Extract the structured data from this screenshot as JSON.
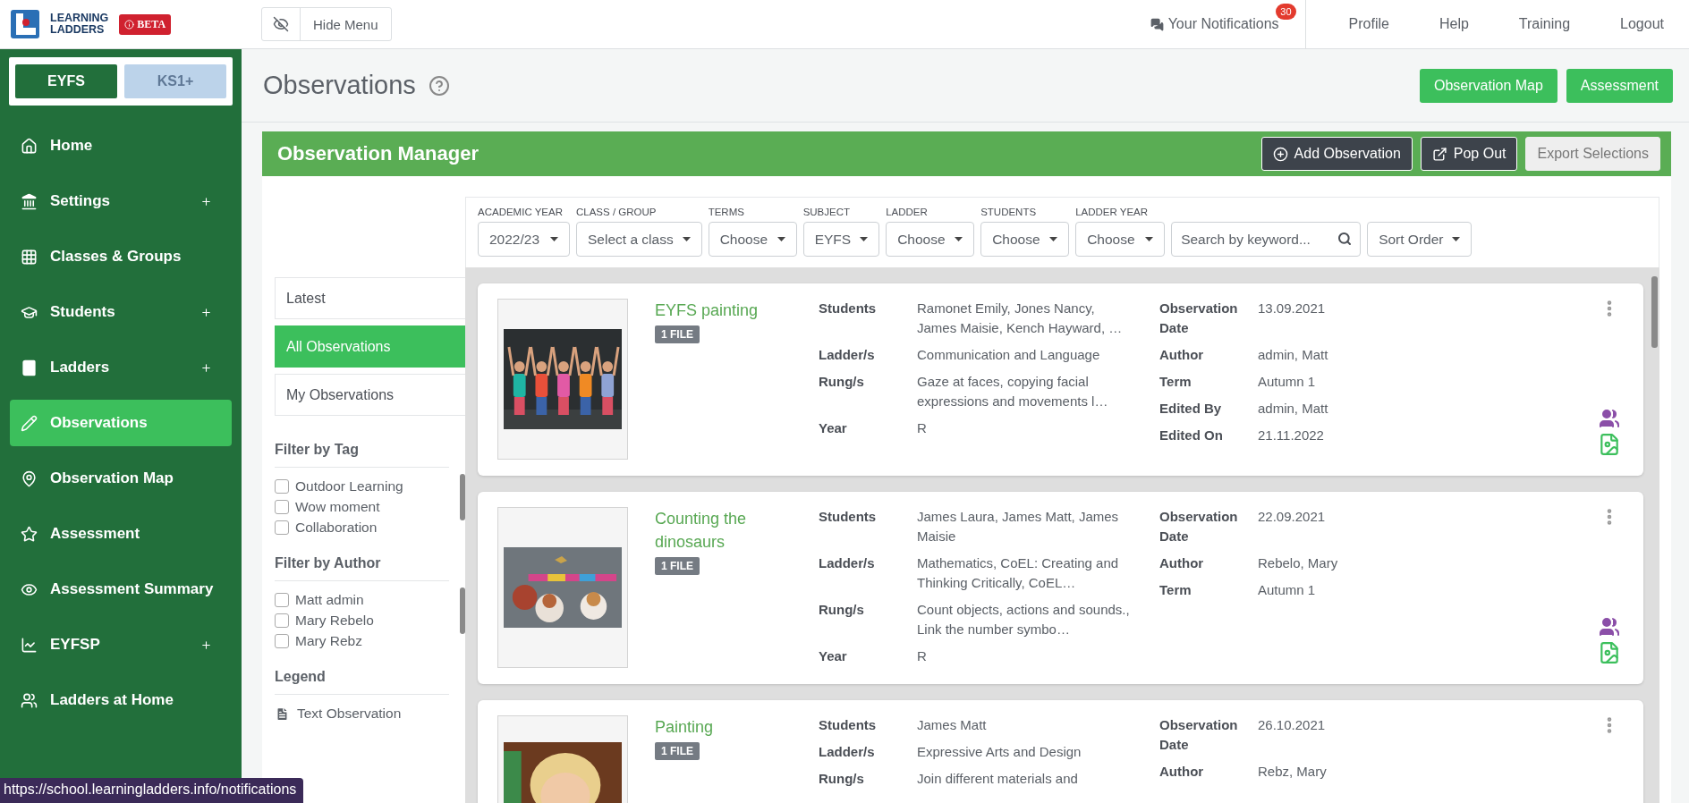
{
  "brand": {
    "line_1": "LEARNING",
    "line_2": "LADDERS",
    "badge": "BETA"
  },
  "hide_menu": "Hide Menu",
  "top_nav": {
    "notifications": {
      "label": "Your Notifications",
      "count": "30"
    },
    "links": [
      "Profile",
      "Help",
      "Training",
      "Logout"
    ]
  },
  "stage_toggle": [
    {
      "label": "EYFS",
      "selected": true
    },
    {
      "label": "KS1+",
      "selected": false
    }
  ],
  "sidebar": {
    "items": [
      {
        "label": "Home",
        "expandable": false,
        "selected": false
      },
      {
        "label": "Settings",
        "expandable": true,
        "selected": false
      },
      {
        "label": "Classes & Groups",
        "expandable": false,
        "selected": false
      },
      {
        "label": "Students",
        "expandable": true,
        "selected": false
      },
      {
        "label": "Ladders",
        "expandable": true,
        "selected": false
      },
      {
        "label": "Observations",
        "expandable": false,
        "selected": true
      },
      {
        "label": "Observation Map",
        "expandable": false,
        "selected": false
      },
      {
        "label": "Assessment",
        "expandable": false,
        "selected": false
      },
      {
        "label": "Assessment Summary",
        "expandable": false,
        "selected": false
      },
      {
        "label": "EYFSP",
        "expandable": true,
        "selected": false
      },
      {
        "label": "Ladders at Home",
        "expandable": false,
        "selected": false
      }
    ]
  },
  "page": {
    "title": "Observations",
    "buttons": [
      "Observation Map",
      "Assessment"
    ]
  },
  "manager": {
    "title": "Observation Manager",
    "actions": [
      {
        "label": "Add Observation",
        "kind": "add"
      },
      {
        "label": "Pop Out",
        "kind": "popout"
      },
      {
        "label": "Export Selections",
        "kind": "disabled"
      }
    ]
  },
  "views": [
    {
      "label": "Latest",
      "selected": false
    },
    {
      "label": "All Observations",
      "selected": true
    },
    {
      "label": "My Observations",
      "selected": false
    }
  ],
  "filter_groups": [
    {
      "title": "Filter by Tag",
      "options": [
        {
          "label": "Outdoor Learning",
          "checked": false
        },
        {
          "label": "Wow moment",
          "checked": false
        },
        {
          "label": "Collaboration",
          "checked": false
        }
      ]
    },
    {
      "title": "Filter by Author",
      "options": [
        {
          "label": "Matt admin",
          "checked": false
        },
        {
          "label": "Mary Rebelo",
          "checked": false
        },
        {
          "label": "Mary Rebz",
          "checked": false
        }
      ]
    }
  ],
  "legend": {
    "title": "Legend",
    "items": [
      "Text Observation"
    ]
  },
  "filters": [
    {
      "label": "ACADEMIC YEAR",
      "value": "2022/23"
    },
    {
      "label": "CLASS / GROUP",
      "value": "Select a class"
    },
    {
      "label": "TERMS",
      "value": "Choose"
    },
    {
      "label": "SUBJECT",
      "value": "EYFS"
    },
    {
      "label": "LADDER",
      "value": "Choose"
    },
    {
      "label": "STUDENTS",
      "value": "Choose"
    },
    {
      "label": "LADDER YEAR",
      "value": "Choose"
    }
  ],
  "search": {
    "placeholder": "Search by keyword..."
  },
  "sort": {
    "value": "Sort Order"
  },
  "observations": [
    {
      "title": "EYFS painting",
      "badge": "1 FILE",
      "picture": {
        "kind": "picture"
      },
      "group": true,
      "media": true,
      "fields": [
        {
          "label": "Students",
          "value": "Ramonet Emily, Jones Nancy, James Maisie, Kench Hayward, …"
        },
        {
          "label": "Ladder/s",
          "value": "Communication and Language"
        },
        {
          "label": "Rung/s",
          "value": "Gaze at faces, copying facial expressions and movements l…"
        },
        {
          "label": "Year",
          "value": "R"
        }
      ],
      "meta": [
        {
          "label": "Observation Date",
          "value": "13.09.2021"
        },
        {
          "label": "Author",
          "value": "admin, Matt"
        },
        {
          "label": "Term",
          "value": "Autumn 1"
        },
        {
          "label": "Edited By",
          "value": "admin, Matt"
        },
        {
          "label": "Edited On",
          "value": "21.11.2022"
        }
      ]
    },
    {
      "title": "Counting the dinosaurs",
      "badge": "1 FILE",
      "picture": {
        "kind": "picture"
      },
      "group": true,
      "media": true,
      "fields": [
        {
          "label": "Students",
          "value": "James Laura, James Matt, James Maisie"
        },
        {
          "label": "Ladder/s",
          "value": "Mathematics, CoEL: Creating and Thinking Critically, CoEL…"
        },
        {
          "label": "Rung/s",
          "value": "Count objects, actions and sounds., Link the number symbo…"
        },
        {
          "label": "Year",
          "value": "R"
        }
      ],
      "meta": [
        {
          "label": "Observation Date",
          "value": "22.09.2021"
        },
        {
          "label": "Author",
          "value": "Rebelo, Mary"
        },
        {
          "label": "Term",
          "value": "Autumn 1"
        }
      ]
    },
    {
      "title": "Painting",
      "badge": "1 FILE",
      "picture": {
        "kind": "picture"
      },
      "fields": [
        {
          "label": "Students",
          "value": "James Matt"
        },
        {
          "label": "Ladder/s",
          "value": "Expressive Arts and Design"
        },
        {
          "label": "Rung/s",
          "value": "Join different materials and"
        }
      ],
      "meta": [
        {
          "label": "Observation Date",
          "value": "26.10.2021"
        },
        {
          "label": "Author",
          "value": "Rebz, Mary"
        }
      ]
    }
  ],
  "status_url": "https://school.learningladders.info/notifications"
}
